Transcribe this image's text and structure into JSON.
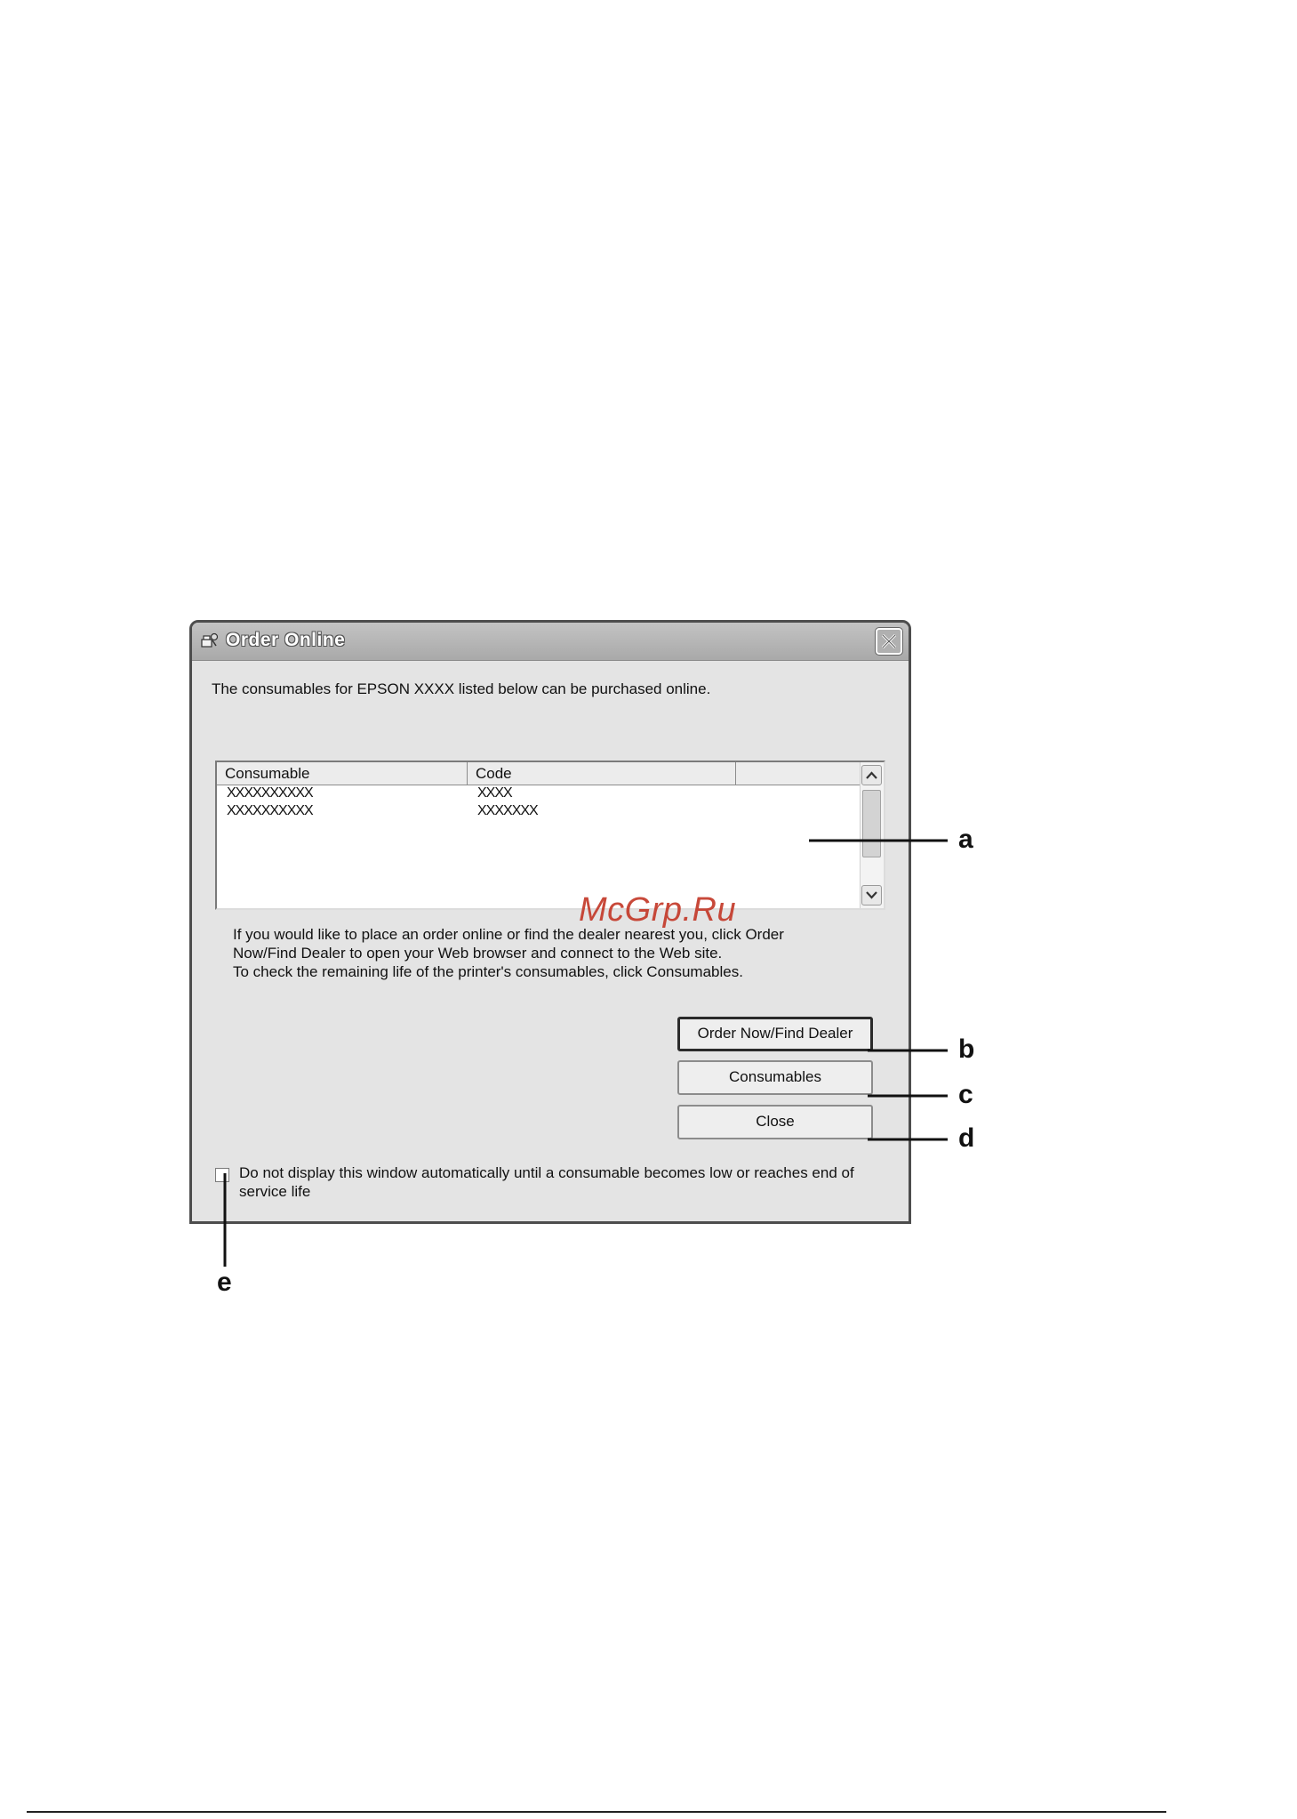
{
  "dialog": {
    "title": "Order Online",
    "intro": "The consumables for EPSON XXXX listed below can be purchased online.",
    "list": {
      "columns": [
        "Consumable",
        "Code",
        ""
      ],
      "rows": [
        {
          "consumable": "XXXXXXXXXX",
          "code": "XXXX"
        },
        {
          "consumable": "XXXXXXXXXX",
          "code": "XXXXXXX"
        }
      ]
    },
    "help_lines": [
      "If you would like to place an order online or find the dealer nearest you, click Order",
      "Now/Find Dealer to open your Web browser and connect to the Web site.",
      "To check the remaining life of the printer's consumables, click Consumables."
    ],
    "buttons": {
      "order_now": "Order Now/Find Dealer",
      "consumables": "Consumables",
      "close": "Close"
    },
    "checkbox_label": "Do not display this window automatically until a consumable becomes low or reaches end of service life",
    "checkbox_checked": false
  },
  "callouts": {
    "a": "a",
    "b": "b",
    "c": "c",
    "d": "d",
    "e": "e"
  },
  "watermark": "McGrp.Ru"
}
